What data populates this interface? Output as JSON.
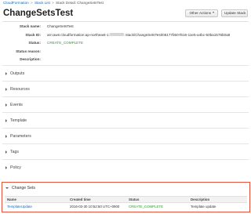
{
  "breadcrumb": {
    "root": "CloudFormation",
    "sep1": ">",
    "list": "Stack List",
    "sep2": ">",
    "detail": "Stack Detail: ChangeSetsTest"
  },
  "page_title": "ChangeSetsTest",
  "toolbar": {
    "other_actions_label": "Other Actions",
    "update_stack_label": "Update Stack"
  },
  "details": {
    "stack_name_label": "Stack name:",
    "stack_name_value": "ChangeSetsTest",
    "stack_id_label": "Stack ID:",
    "stack_id_prefix": "arn:aws:cloudformation:ap-northeast-1:",
    "stack_id_suffix": ":stack/ChangeSetsTest/06177b50-f616-11e5-a4bc-50ba1578b0a8",
    "status_label": "Status:",
    "status_value": "CREATE_COMPLETE",
    "status_reason_label": "Status reason:",
    "status_reason_value": "",
    "description_label": "Description:",
    "description_value": ""
  },
  "sections": [
    "Outputs",
    "Resources",
    "Events",
    "Template",
    "Parameters",
    "Tags",
    "Policy"
  ],
  "change_sets": {
    "title": "Change Sets",
    "columns": [
      "Name",
      "Created time",
      "Status",
      "Description"
    ],
    "rows": [
      {
        "name": "TemplateUpdate",
        "created": "2016-03-30 10:52:50 UTC+0900",
        "status": "CREATE_COMPLETE",
        "description": "Template update"
      }
    ]
  },
  "colors": {
    "link": "#1a66b5",
    "status_green": "#2d9c2d",
    "highlight_border": "#e5533d"
  }
}
